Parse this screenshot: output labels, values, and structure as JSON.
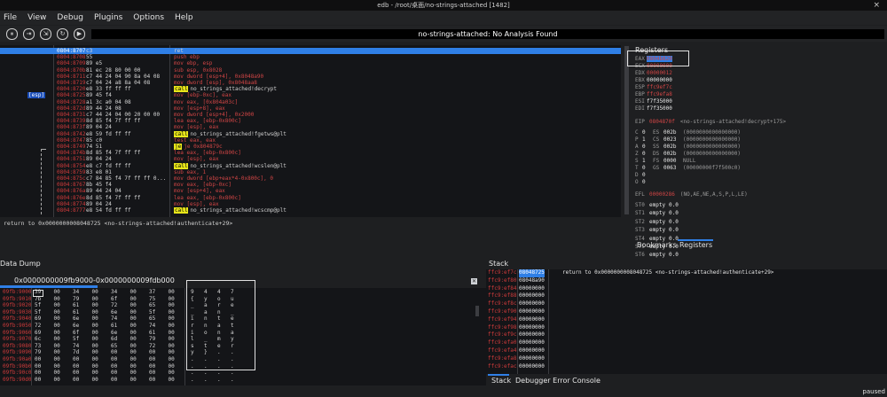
{
  "window": {
    "title": "edb - /root/桌面/no-strings-attached [1482]",
    "close": "×"
  },
  "menu": [
    "File",
    "View",
    "Debug",
    "Plugins",
    "Options",
    "Help"
  ],
  "toolbar": {
    "buttons": [
      "⏸",
      "⇥",
      "⇲",
      "↻",
      "▶"
    ]
  },
  "status": "no-strings-attached: No Analysis Found",
  "cpu": {
    "esp_tag": "[esp]",
    "rows": [
      {
        "addr": "0804:8707",
        "bytes": "c3",
        "ins": "ret",
        "style": "sel"
      },
      {
        "addr": "0804:8708",
        "bytes": "55",
        "ins": "push ebp",
        "style": "red"
      },
      {
        "addr": "0804:8709",
        "bytes": "89 e5",
        "ins": "mov ebp, esp",
        "style": "red"
      },
      {
        "addr": "0804:870b",
        "bytes": "81 ec 28 80 00 00",
        "ins": "sub esp, 0x8028",
        "style": "red"
      },
      {
        "addr": "0804:8711",
        "bytes": "c7 44 24 04 90 8a 04 08",
        "ins": "mov dword [esp+4], 0x8048a90",
        "style": "red"
      },
      {
        "addr": "0804:8719",
        "bytes": "c7 04 24 a8 8a 04 08",
        "ins": "mov dword [esp], 0x8048aa8",
        "style": "red"
      },
      {
        "addr": "0804:8720",
        "bytes": "e8 33 ff ff ff",
        "ins": "no_strings_attached!decrypt",
        "style": "call"
      },
      {
        "addr": "0804:8725",
        "bytes": "89 45 f4",
        "ins": "mov [ebp-0xc], eax",
        "style": "red"
      },
      {
        "addr": "0804:8728",
        "bytes": "a1 3c a0 04 08",
        "ins": "mov eax, [0x804a03c]",
        "style": "red"
      },
      {
        "addr": "0804:872d",
        "bytes": "89 44 24 08",
        "ins": "mov [esp+8], eax",
        "style": "red"
      },
      {
        "addr": "0804:8731",
        "bytes": "c7 44 24 04 00 20 00 00",
        "ins": "mov dword [esp+4], 0x2000",
        "style": "red"
      },
      {
        "addr": "0804:8739",
        "bytes": "8d 85 f4 7f ff ff",
        "ins": "lea eax, [ebp-0x800c]",
        "style": "red"
      },
      {
        "addr": "0804:873f",
        "bytes": "89 04 24",
        "ins": "mov [esp], eax",
        "style": "red"
      },
      {
        "addr": "0804:8742",
        "bytes": "e8 59 fd ff ff",
        "ins": "no_strings_attached!fgetws@plt",
        "style": "call"
      },
      {
        "addr": "0804:8747",
        "bytes": "85 c0",
        "ins": "test eax, eax",
        "style": "red"
      },
      {
        "addr": "0804:8749",
        "bytes": "74 51",
        "ins": "je 0x804879c",
        "style": "je"
      },
      {
        "addr": "0804:874b",
        "bytes": "8d 85 f4 7f ff ff",
        "ins": "lea eax, [ebp-0x800c]",
        "style": "red"
      },
      {
        "addr": "0804:8751",
        "bytes": "89 04 24",
        "ins": "mov [esp], eax",
        "style": "red"
      },
      {
        "addr": "0804:8754",
        "bytes": "e8 c7 fd ff ff",
        "ins": "no_strings_attached!wcslen@plt",
        "style": "call"
      },
      {
        "addr": "0804:8759",
        "bytes": "83 e8 01",
        "ins": "sub eax, 1",
        "style": "red"
      },
      {
        "addr": "0804:875c",
        "bytes": "c7 84 85 f4 7f ff ff 0...",
        "ins": "mov dword [ebp+eax*4-0x800c], 0",
        "style": "red"
      },
      {
        "addr": "0804:8767",
        "bytes": "8b 45 f4",
        "ins": "mov eax, [ebp-0xc]",
        "style": "red"
      },
      {
        "addr": "0804:876a",
        "bytes": "89 44 24 04",
        "ins": "mov [esp+4], eax",
        "style": "red"
      },
      {
        "addr": "0804:876e",
        "bytes": "8d 85 f4 7f ff ff",
        "ins": "lea eax, [ebp-0x800c]",
        "style": "red"
      },
      {
        "addr": "0804:8774",
        "bytes": "89 04 24",
        "ins": "mov [esp], eax",
        "style": "red"
      },
      {
        "addr": "0804:8777",
        "bytes": "e8 54 fd ff ff",
        "ins": "no_strings_attached!wcscmp@plt",
        "style": "call"
      }
    ],
    "status_line": "return to 0x0000000008048725 <no-strings-attached!authenticate+29>"
  },
  "registers": {
    "title": "Registers",
    "gpr": [
      {
        "name": "EAX",
        "value": "0804b820",
        "color": "red",
        "sel": true
      },
      {
        "name": "ECX",
        "value": "00000000",
        "color": "red"
      },
      {
        "name": "EDX",
        "value": "00000012",
        "color": "red"
      },
      {
        "name": "EBX",
        "value": "00000000",
        "color": "wht"
      },
      {
        "name": "ESP",
        "value": "ffc9ef7c",
        "color": "red"
      },
      {
        "name": "EBP",
        "value": "ffc9efa8",
        "color": "red"
      },
      {
        "name": "ESI",
        "value": "f7f35000",
        "color": "wht"
      },
      {
        "name": "EDI",
        "value": "f7f35000",
        "color": "wht"
      }
    ],
    "eip": {
      "name": "EIP",
      "value": "0804870f",
      "comment": "<no-strings-attached!decrypt+175>"
    },
    "flags_segs": [
      {
        "f": "C",
        "fv": "0",
        "seg": "ES",
        "sv": "002b",
        "sc": "(0000000000000000)"
      },
      {
        "f": "P",
        "fv": "1",
        "seg": "CS",
        "sv": "0023",
        "sc": "(0000000000000000)"
      },
      {
        "f": "A",
        "fv": "0",
        "seg": "SS",
        "sv": "002b",
        "sc": "(0000000000000000)"
      },
      {
        "f": "Z",
        "fv": "0",
        "seg": "DS",
        "sv": "002b",
        "sc": "(0000000000000000)"
      },
      {
        "f": "S",
        "fv": "1",
        "seg": "FS",
        "sv": "0000",
        "sc": "NULL"
      },
      {
        "f": "T",
        "fv": "0",
        "seg": "GS",
        "sv": "0063",
        "sc": "(00000000f7f500c0)"
      },
      {
        "f": "D",
        "fv": "0",
        "seg": "",
        "sv": "",
        "sc": ""
      },
      {
        "f": "O",
        "fv": "0",
        "seg": "",
        "sv": "",
        "sc": ""
      }
    ],
    "efl": {
      "name": "EFL",
      "value": "00000286",
      "comment": "(NO,AE,NE,A,S,P,L,LE)"
    },
    "fpu": [
      {
        "n": "ST0",
        "s": "empty",
        "v": "0.0"
      },
      {
        "n": "ST1",
        "s": "empty",
        "v": "0.0"
      },
      {
        "n": "ST2",
        "s": "empty",
        "v": "0.0"
      },
      {
        "n": "ST3",
        "s": "empty",
        "v": "0.0"
      },
      {
        "n": "ST4",
        "s": "empty",
        "v": "0.0"
      },
      {
        "n": "ST5",
        "s": "empty",
        "v": "0.0"
      },
      {
        "n": "ST6",
        "s": "empty",
        "v": "0.0"
      }
    ],
    "tabs": {
      "bookmarks": "Bookmarks",
      "registers": "Registers"
    }
  },
  "dump": {
    "title": "Data Dump",
    "range": "0x0000000009fb9000-0x0000000009fdb000",
    "rows": [
      {
        "addr": "09fb:9000",
        "bytes": [
          "39",
          "00",
          "34",
          "00",
          "34",
          "00",
          "37",
          "00"
        ],
        "ascii": [
          "9",
          "4",
          "4",
          "7"
        ]
      },
      {
        "addr": "09fb:9010",
        "bytes": [
          "7b",
          "00",
          "79",
          "00",
          "6f",
          "00",
          "75",
          "00"
        ],
        "ascii": [
          "{",
          "y",
          "o",
          "u"
        ]
      },
      {
        "addr": "09fb:9020",
        "bytes": [
          "5f",
          "00",
          "61",
          "00",
          "72",
          "00",
          "65",
          "00"
        ],
        "ascii": [
          "_",
          "a",
          "r",
          "e"
        ]
      },
      {
        "addr": "09fb:9030",
        "bytes": [
          "5f",
          "00",
          "61",
          "00",
          "6e",
          "00",
          "5f",
          "00"
        ],
        "ascii": [
          "_",
          "a",
          "n",
          "_"
        ]
      },
      {
        "addr": "09fb:9040",
        "bytes": [
          "69",
          "00",
          "6e",
          "00",
          "74",
          "00",
          "65",
          "00"
        ],
        "ascii": [
          "i",
          "n",
          "t",
          "e"
        ]
      },
      {
        "addr": "09fb:9050",
        "bytes": [
          "72",
          "00",
          "6e",
          "00",
          "61",
          "00",
          "74",
          "00"
        ],
        "ascii": [
          "r",
          "n",
          "a",
          "t"
        ]
      },
      {
        "addr": "09fb:9060",
        "bytes": [
          "69",
          "00",
          "6f",
          "00",
          "6e",
          "00",
          "61",
          "00"
        ],
        "ascii": [
          "i",
          "o",
          "n",
          "a"
        ]
      },
      {
        "addr": "09fb:9070",
        "bytes": [
          "6c",
          "00",
          "5f",
          "00",
          "6d",
          "00",
          "79",
          "00"
        ],
        "ascii": [
          "l",
          "_",
          "m",
          "y"
        ]
      },
      {
        "addr": "09fb:9080",
        "bytes": [
          "73",
          "00",
          "74",
          "00",
          "65",
          "00",
          "72",
          "00"
        ],
        "ascii": [
          "s",
          "t",
          "e",
          "r"
        ]
      },
      {
        "addr": "09fb:9090",
        "bytes": [
          "79",
          "00",
          "7d",
          "00",
          "00",
          "00",
          "00",
          "00"
        ],
        "ascii": [
          "y",
          "}",
          ".",
          "."
        ]
      },
      {
        "addr": "09fb:90a0",
        "bytes": [
          "00",
          "00",
          "00",
          "00",
          "00",
          "00",
          "00",
          "00"
        ],
        "ascii": [
          ".",
          ".",
          ".",
          "."
        ]
      },
      {
        "addr": "09fb:90b0",
        "bytes": [
          "00",
          "00",
          "00",
          "00",
          "00",
          "00",
          "00",
          "00"
        ],
        "ascii": [
          ".",
          ".",
          ".",
          "."
        ]
      },
      {
        "addr": "09fb:90c0",
        "bytes": [
          "00",
          "00",
          "00",
          "00",
          "00",
          "00",
          "00",
          "00"
        ],
        "ascii": [
          ".",
          ".",
          ".",
          "."
        ]
      },
      {
        "addr": "09fb:90d0",
        "bytes": [
          "00",
          "00",
          "00",
          "00",
          "00",
          "00",
          "00",
          "00"
        ],
        "ascii": [
          ".",
          ".",
          ".",
          "."
        ]
      }
    ]
  },
  "stack": {
    "title": "Stack",
    "rows": [
      {
        "addr": "ffc9:ef7c",
        "value": "08048725",
        "comment": "return to 0x0000000008048725 <no-strings-attached!authenticate+29>"
      },
      {
        "addr": "ffc9:ef80",
        "value": "08048a90",
        "comment": ""
      },
      {
        "addr": "ffc9:ef84",
        "value": "00000000",
        "comment": ""
      },
      {
        "addr": "ffc9:ef88",
        "value": "00000000",
        "comment": ""
      },
      {
        "addr": "ffc9:ef8c",
        "value": "00000000",
        "comment": ""
      },
      {
        "addr": "ffc9:ef90",
        "value": "00000000",
        "comment": ""
      },
      {
        "addr": "ffc9:ef94",
        "value": "00000000",
        "comment": ""
      },
      {
        "addr": "ffc9:ef98",
        "value": "00000000",
        "comment": ""
      },
      {
        "addr": "ffc9:ef9c",
        "value": "00000000",
        "comment": ""
      },
      {
        "addr": "ffc9:efa0",
        "value": "00000000",
        "comment": ""
      },
      {
        "addr": "ffc9:efa4",
        "value": "00000000",
        "comment": ""
      },
      {
        "addr": "ffc9:efa8",
        "value": "00000000",
        "comment": ""
      },
      {
        "addr": "ffc9:efac",
        "value": "00000000",
        "comment": ""
      }
    ],
    "tabs": {
      "stack": "Stack",
      "console": "Debugger Error Console"
    }
  },
  "paused": "paused"
}
